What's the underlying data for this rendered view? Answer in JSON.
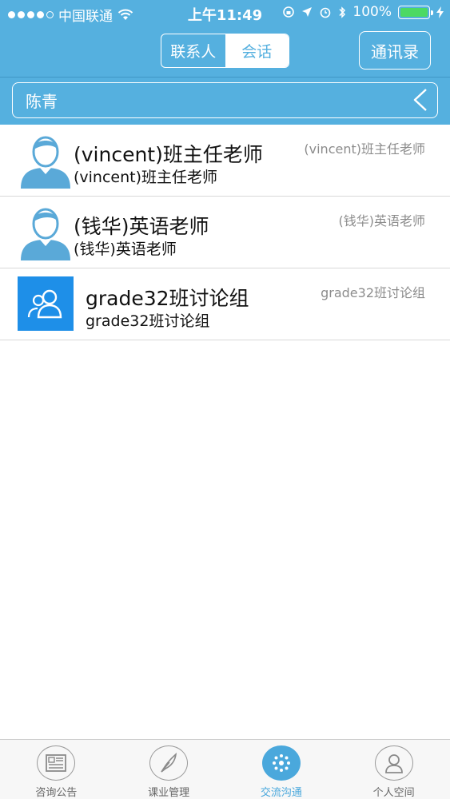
{
  "status_bar": {
    "carrier": "中国联通",
    "time": "上午11:49",
    "battery": "100%",
    "battery_level": 1.0
  },
  "header": {
    "segments": [
      {
        "label": "联系人",
        "active": false
      },
      {
        "label": "会话",
        "active": true
      }
    ],
    "address_book_label": "通讯录"
  },
  "name_field": {
    "value": "陈青"
  },
  "conversations": [
    {
      "title": "(vincent)班主任老师",
      "subtitle": "(vincent)班主任老师",
      "right_label": "(vincent)班主任老师",
      "avatar": "person-icon"
    },
    {
      "title": "(钱华)英语老师",
      "subtitle": "(钱华)英语老师",
      "right_label": "(钱华)英语老师",
      "avatar": "person-icon"
    },
    {
      "title": "grade32班讨论组",
      "subtitle": "grade32班讨论组",
      "right_label": "grade32班讨论组",
      "avatar": "group-icon"
    }
  ],
  "tab_bar": {
    "tabs": [
      {
        "label": "咨询公告",
        "icon": "newspaper-icon",
        "active": false
      },
      {
        "label": "课业管理",
        "icon": "feather-icon",
        "active": false
      },
      {
        "label": "交流沟通",
        "icon": "chat-hub-icon",
        "active": true
      },
      {
        "label": "个人空间",
        "icon": "person-icon",
        "active": false
      }
    ]
  },
  "colors": {
    "header_blue": "#55b0df",
    "accent_blue": "#4aa8dc",
    "group_avatar_blue": "#1e8fe8",
    "avatar_blue": "#5aa9d8"
  }
}
